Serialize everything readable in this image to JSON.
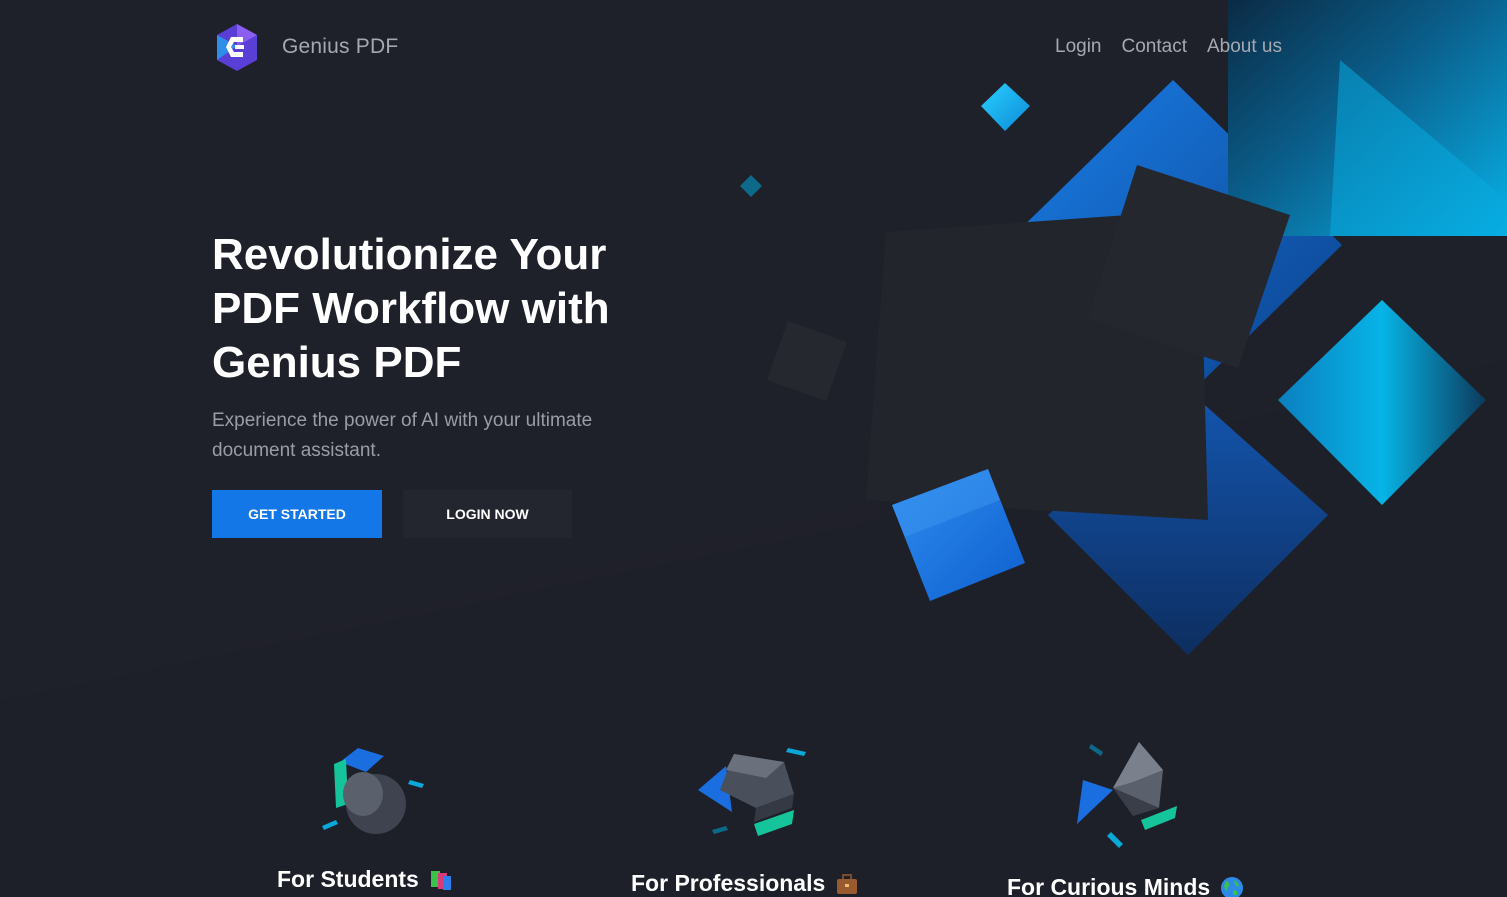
{
  "header": {
    "brand": "Genius PDF",
    "nav": [
      "Login",
      "Contact",
      "About us"
    ]
  },
  "hero": {
    "title": "Revolutionize Your PDF Workflow with Genius PDF",
    "subtitle": "Experience the power of AI with your ultimate document assistant.",
    "primary_button": "GET STARTED",
    "secondary_button": "LOGIN NOW"
  },
  "features": [
    {
      "title": "For Students",
      "icon": "books-emoji-icon"
    },
    {
      "title": "For Professionals",
      "icon": "briefcase-emoji-icon"
    },
    {
      "title": "For Curious Minds",
      "icon": "globe-emoji-icon"
    }
  ],
  "colors": {
    "background": "#1e2029",
    "accent": "#1477e8",
    "cyan": "#0ab4e8",
    "secondary_button": "#23262f"
  }
}
